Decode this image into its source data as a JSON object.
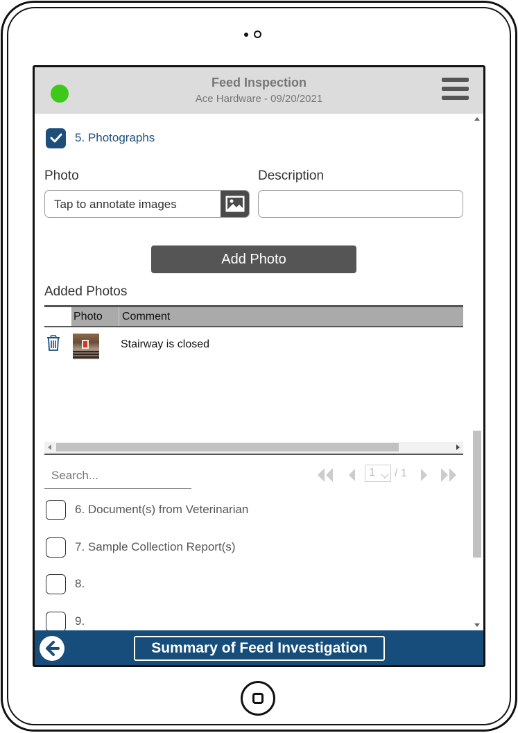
{
  "header": {
    "title": "Feed Inspection",
    "subtitle": "Ace Hardware - 09/20/2021",
    "status_color": "#3cc919"
  },
  "sections": {
    "current": {
      "label": "5. Photographs",
      "checked": true
    }
  },
  "photo_form": {
    "photo_label": "Photo",
    "photo_placeholder": "Tap to annotate images",
    "description_label": "Description",
    "description_value": "",
    "add_button": "Add Photo"
  },
  "added_photos": {
    "title": "Added Photos",
    "columns": [
      "Photo",
      "Comment"
    ],
    "rows": [
      {
        "icon": "trash-icon",
        "thumbnail": "stairway-photo",
        "comment": "Stairway is closed"
      }
    ]
  },
  "grid_footer": {
    "search_placeholder": "Search...",
    "page_current": "1",
    "page_total": "/ 1"
  },
  "checklist": [
    {
      "label": "6. Document(s) from Veterinarian",
      "checked": false
    },
    {
      "label": "7. Sample Collection Report(s)",
      "checked": false
    },
    {
      "label": "8.",
      "checked": false
    },
    {
      "label": "9.",
      "checked": false
    }
  ],
  "footer": {
    "button": "Summary of Feed Investigation",
    "back_icon": "arrow-left-icon",
    "bar_color": "#164d7b"
  }
}
